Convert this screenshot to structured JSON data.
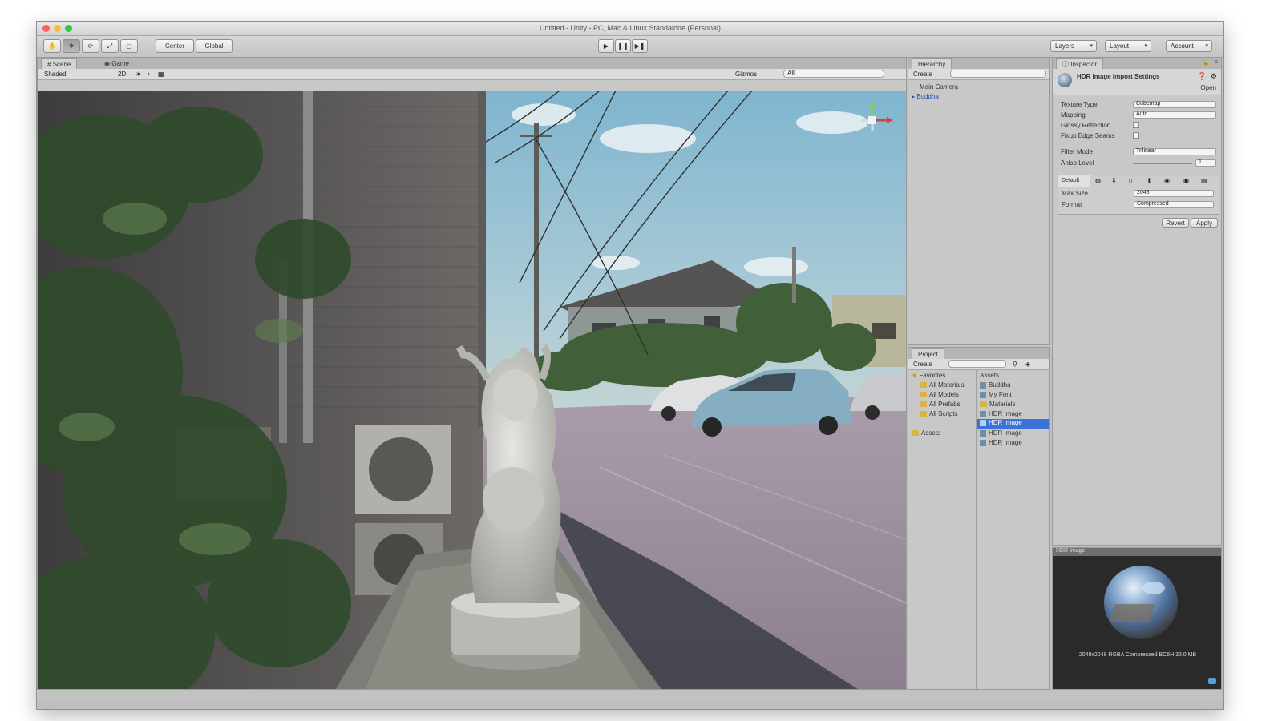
{
  "window": {
    "title": "Untitled - Unity - PC, Mac & Linux Standalone (Personal)",
    "traffic_lights": {
      "close": "#fc615d",
      "minimize": "#fdbc40",
      "zoom": "#34c84a"
    }
  },
  "toolbar": {
    "pivot_label": "Center",
    "space_label": "Global",
    "layers_label": "Layers",
    "layout_label": "Layout",
    "account_label": "Account",
    "play_icon": "play-icon",
    "pause_icon": "pause-icon",
    "step_icon": "step-icon"
  },
  "scene": {
    "tabs": [
      "Scene",
      "Game"
    ],
    "shading_mode": "Shaded",
    "mode_2d": "2D",
    "gizmos_label": "Gizmos",
    "search_placeholder": "All"
  },
  "hierarchy": {
    "tab": "Hierarchy",
    "create_label": "Create",
    "items": [
      "Main Camera",
      "Buddha"
    ]
  },
  "project": {
    "tab": "Project",
    "create_label": "Create",
    "favorites_label": "Favorites",
    "favorites": [
      "All Materials",
      "All Models",
      "All Prefabs",
      "All Scripts"
    ],
    "assets_label": "Assets",
    "assets": [
      "Buddha",
      "My Font",
      "Materials",
      "HDR Image",
      "HDR Image",
      "HDR Image",
      "HDR Image"
    ],
    "selected_index": 4
  },
  "inspector": {
    "tab": "Inspector",
    "header_title": "HDR Image Import Settings",
    "open_label": "Open",
    "fields": [
      {
        "label": "Texture Type",
        "value": "Cubemap"
      },
      {
        "label": "Mapping",
        "value": "Auto"
      },
      {
        "label": "Glossy Reflection",
        "value": ""
      },
      {
        "label": "Fixup Edge Seams",
        "value": ""
      },
      {
        "label": "Filter Mode",
        "value": "Trilinear"
      },
      {
        "label": "Aniso Level",
        "value": "1"
      }
    ],
    "platform_default": "Default",
    "max_size_label": "Max Size",
    "max_size_value": "2048",
    "format_label": "Format",
    "format_value": "Compressed",
    "revert_label": "Revert",
    "apply_label": "Apply"
  },
  "preview": {
    "title": "HDR Image",
    "info": "2048x2048  RGBA Compressed BC6H  32.0 MB"
  }
}
